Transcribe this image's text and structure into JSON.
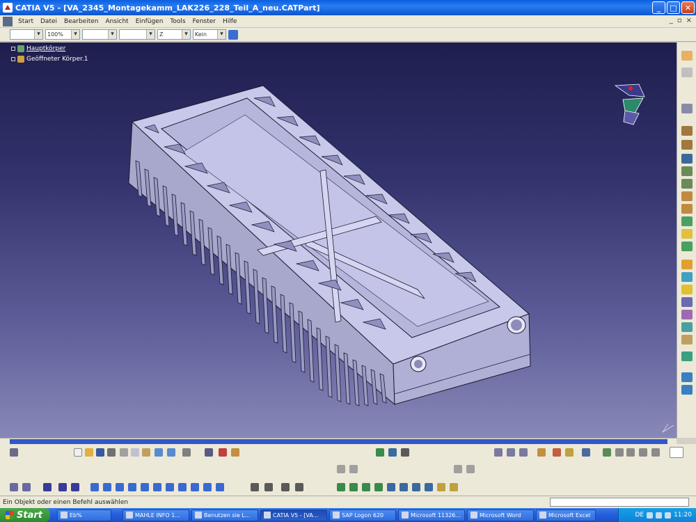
{
  "window": {
    "title": "CATIA V5 - [VA_2345_Montagekamm_LAK226_228_Teil_A_neu.CATPart]"
  },
  "menu": {
    "items": [
      "Start",
      "Datei",
      "Bearbeiten",
      "Ansicht",
      "Einfügen",
      "Tools",
      "Fenster",
      "Hilfe"
    ]
  },
  "format_toolbar": {
    "font_combo": "",
    "zoom_combo": "100%",
    "linetype_combo": "",
    "thickness_combo": "",
    "layer_combo": "Z",
    "pattern_combo": "Kein"
  },
  "tree": {
    "items": [
      {
        "label": "Hauptkörper",
        "selected": true
      },
      {
        "label": "Geöffneter Körper.1",
        "selected": false
      }
    ]
  },
  "status": {
    "text": "Ein Objekt oder einen Befehl auswählen"
  },
  "taskbar": {
    "start_label": "Start",
    "tasks": [
      {
        "label": "Eb%",
        "active": false
      },
      {
        "label": "MAHLE INFO 1...",
        "active": false
      },
      {
        "label": "Benutzen sie L...",
        "active": false
      },
      {
        "label": "CATIA V5 - [VA...",
        "active": true
      },
      {
        "label": "SAP Logon 620",
        "active": false
      },
      {
        "label": "Microsoft 11326...",
        "active": false
      },
      {
        "label": "Microsoft Word",
        "active": false
      },
      {
        "label": "Microsoft Excel",
        "active": false
      }
    ],
    "tray_lang": "DE",
    "clock": "11:20"
  },
  "colors": {
    "viewport_top": "#1e1e4e",
    "viewport_bottom": "#8888b8",
    "part_face": "#c8c8ea",
    "part_edge": "#1a1a30"
  }
}
